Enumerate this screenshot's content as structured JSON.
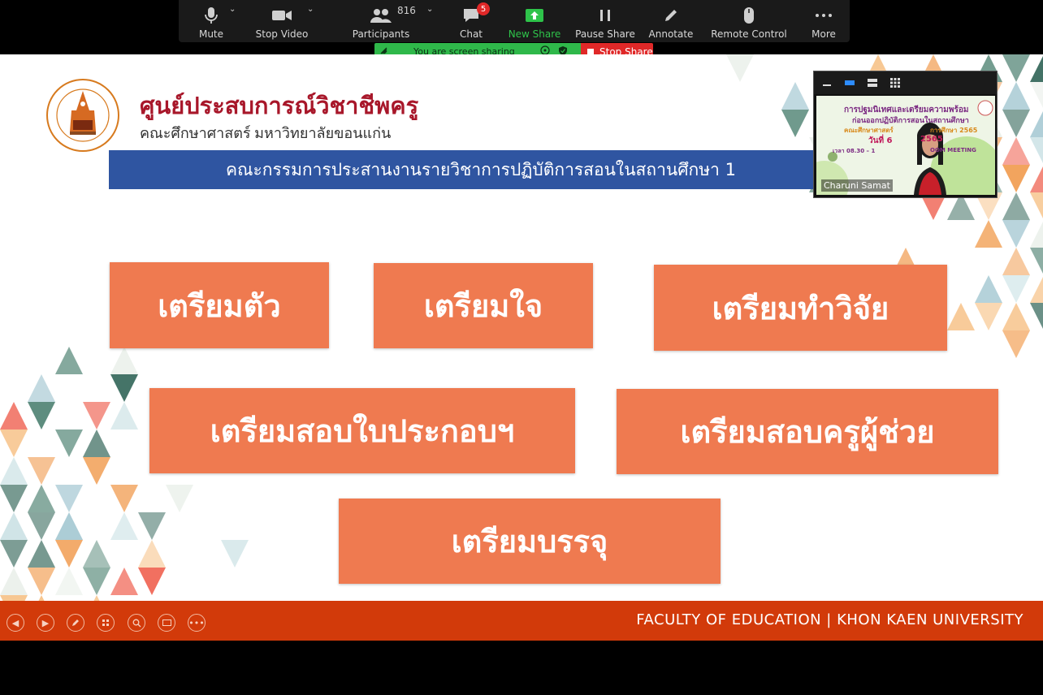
{
  "toolbar": {
    "mute": "Mute",
    "stop_video": "Stop Video",
    "participants": "Participants",
    "participants_count": "816",
    "chat": "Chat",
    "chat_badge": "5",
    "new_share": "New Share",
    "pause_share": "Pause Share",
    "annotate": "Annotate",
    "remote_control": "Remote Control",
    "more": "More"
  },
  "sharing": {
    "status": "You are screen sharing",
    "stop_label": "Stop Share",
    "status_color": "#2fb84a",
    "stop_color": "#e02828"
  },
  "slide": {
    "org_title": "ศูนย์ประสบการณ์วิชาชีพครู",
    "org_subtitle": "คณะศึกษาศาสตร์ มหาวิทยาลัยขอนแก่น",
    "committee": "คณะกรรมการประสานงานรายวิชาการปฏิบัติการสอนในสถานศึกษา 1",
    "boxes": [
      "เตรียมตัว",
      "เตรียมใจ",
      "เตรียมทำวิจัย",
      "เตรียมสอบใบประกอบฯ",
      "เตรียมสอบครูผู้ช่วย",
      "เตรียมบรรจุ"
    ],
    "footer": "FACULTY OF EDUCATION | KHON KAEN UNIVERSITY",
    "box_color": "#ef7a50",
    "band_color": "#2f55a1",
    "footer_color": "#d23a0a"
  },
  "video": {
    "participant_name": "Charuni Samat",
    "slide_line1": "การปฐมนิเทศและเตรียมความพร้อม",
    "slide_line2": "ก่อนออกปฏิบัติการสอนในสถานศึกษา",
    "slide_line3": "คณะศึกษาศาสตร์",
    "slide_line3b": "การศึกษา 2565",
    "slide_line4": "วันที่ 6",
    "slide_line4b": "2565",
    "slide_line5": "เวลา 08.30 – 1",
    "slide_line5b": "OOM MEETING"
  },
  "footer_nav_icons": [
    "prev-icon",
    "next-icon",
    "pen-icon",
    "slides-icon",
    "zoom-icon",
    "subtitle-icon",
    "more-icon"
  ]
}
